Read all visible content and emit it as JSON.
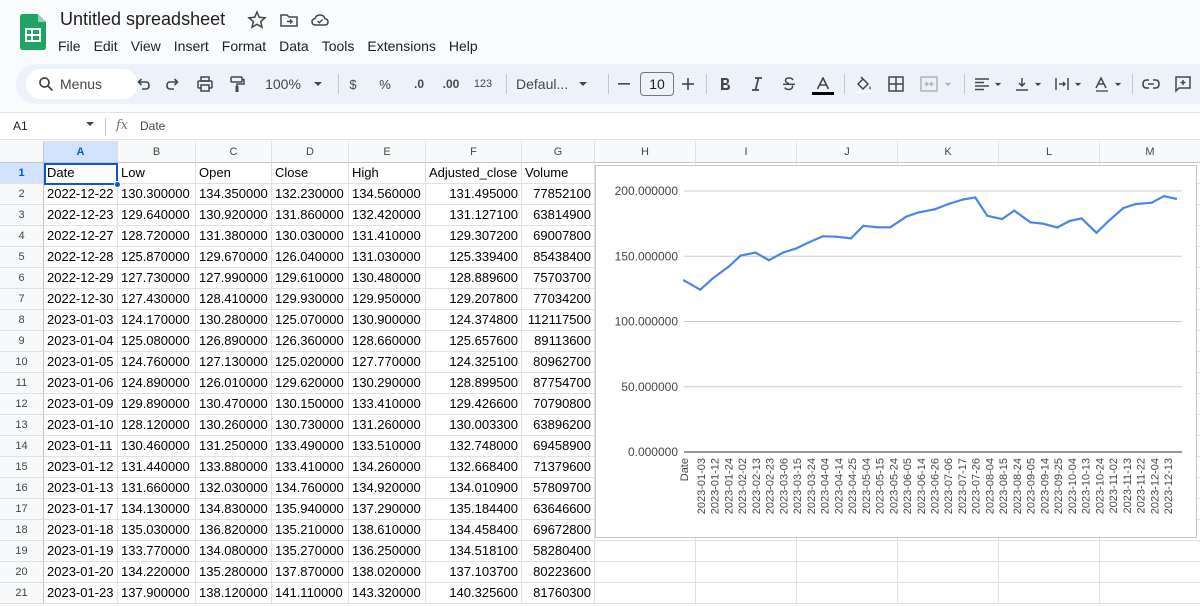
{
  "app": {
    "title": "Untitled spreadsheet",
    "menu": [
      "File",
      "Edit",
      "View",
      "Insert",
      "Format",
      "Data",
      "Tools",
      "Extensions",
      "Help"
    ]
  },
  "toolbar": {
    "search_label": "Menus",
    "zoom": "100%",
    "currency": "$",
    "percent": "%",
    "decrease_decimal": ".0",
    "increase_decimal": ".00",
    "number_format": "123",
    "font": "Defaul...",
    "font_size": "10"
  },
  "formula_bar": {
    "cell_ref": "A1",
    "fx": "fx",
    "value": "Date"
  },
  "grid": {
    "columns": [
      "A",
      "B",
      "C",
      "D",
      "E",
      "F",
      "G",
      "H",
      "I",
      "J",
      "K",
      "L",
      "M"
    ],
    "row_numbers": [
      "1",
      "2",
      "3",
      "4",
      "5",
      "6",
      "7",
      "8",
      "9",
      "10",
      "11",
      "12",
      "13",
      "14",
      "15",
      "16",
      "17",
      "18",
      "19",
      "20",
      "21"
    ],
    "header_row": [
      "Date",
      "Low",
      "Open",
      "Close",
      "High",
      "Adjusted_close",
      "Volume"
    ],
    "rows": [
      [
        "2022-12-22",
        "130.300000",
        "134.350000",
        "132.230000",
        "134.560000",
        "131.495000",
        "77852100"
      ],
      [
        "2022-12-23",
        "129.640000",
        "130.920000",
        "131.860000",
        "132.420000",
        "131.127100",
        "63814900"
      ],
      [
        "2022-12-27",
        "128.720000",
        "131.380000",
        "130.030000",
        "131.410000",
        "129.307200",
        "69007800"
      ],
      [
        "2022-12-28",
        "125.870000",
        "129.670000",
        "126.040000",
        "131.030000",
        "125.339400",
        "85438400"
      ],
      [
        "2022-12-29",
        "127.730000",
        "127.990000",
        "129.610000",
        "130.480000",
        "128.889600",
        "75703700"
      ],
      [
        "2022-12-30",
        "127.430000",
        "128.410000",
        "129.930000",
        "129.950000",
        "129.207800",
        "77034200"
      ],
      [
        "2023-01-03",
        "124.170000",
        "130.280000",
        "125.070000",
        "130.900000",
        "124.374800",
        "112117500"
      ],
      [
        "2023-01-04",
        "125.080000",
        "126.890000",
        "126.360000",
        "128.660000",
        "125.657600",
        "89113600"
      ],
      [
        "2023-01-05",
        "124.760000",
        "127.130000",
        "125.020000",
        "127.770000",
        "124.325100",
        "80962700"
      ],
      [
        "2023-01-06",
        "124.890000",
        "126.010000",
        "129.620000",
        "130.290000",
        "128.899500",
        "87754700"
      ],
      [
        "2023-01-09",
        "129.890000",
        "130.470000",
        "130.150000",
        "133.410000",
        "129.426600",
        "70790800"
      ],
      [
        "2023-01-10",
        "128.120000",
        "130.260000",
        "130.730000",
        "131.260000",
        "130.003300",
        "63896200"
      ],
      [
        "2023-01-11",
        "130.460000",
        "131.250000",
        "133.490000",
        "133.510000",
        "132.748000",
        "69458900"
      ],
      [
        "2023-01-12",
        "131.440000",
        "133.880000",
        "133.410000",
        "134.260000",
        "132.668400",
        "71379600"
      ],
      [
        "2023-01-13",
        "131.660000",
        "132.030000",
        "134.760000",
        "134.920000",
        "134.010900",
        "57809700"
      ],
      [
        "2023-01-17",
        "134.130000",
        "134.830000",
        "135.940000",
        "137.290000",
        "135.184400",
        "63646600"
      ],
      [
        "2023-01-18",
        "135.030000",
        "136.820000",
        "135.210000",
        "138.610000",
        "134.458400",
        "69672800"
      ],
      [
        "2023-01-19",
        "133.770000",
        "134.080000",
        "135.270000",
        "136.250000",
        "134.518100",
        "58280400"
      ],
      [
        "2023-01-20",
        "134.220000",
        "135.280000",
        "137.870000",
        "138.020000",
        "137.103700",
        "80223600"
      ],
      [
        "2023-01-23",
        "137.900000",
        "138.120000",
        "141.110000",
        "143.320000",
        "140.325600",
        "81760300"
      ]
    ]
  },
  "chart_data": {
    "type": "line",
    "title": "",
    "xlabel": "Date",
    "ylabel": "",
    "ylim": [
      0,
      200
    ],
    "y_ticks": [
      "0.000000",
      "50.000000",
      "100.000000",
      "150.000000",
      "200.000000"
    ],
    "x_tick_labels": [
      "2023-01-03",
      "2023-01-12",
      "2023-01-24",
      "2023-02-02",
      "2023-02-13",
      "2023-02-23",
      "2023-03-06",
      "2023-03-15",
      "2023-03-24",
      "2023-04-04",
      "2023-04-14",
      "2023-04-25",
      "2023-05-04",
      "2023-05-15",
      "2023-05-24",
      "2023-06-05",
      "2023-06-14",
      "2023-06-26",
      "2023-07-06",
      "2023-07-17",
      "2023-07-26",
      "2023-08-04",
      "2023-08-15",
      "2023-08-24",
      "2023-09-05",
      "2023-09-14",
      "2023-09-25",
      "2023-10-04",
      "2023-10-13",
      "2023-10-24",
      "2023-11-02",
      "2023-11-13",
      "2023-11-22",
      "2023-12-04",
      "2023-12-13"
    ],
    "series_color": "#4a86e8",
    "gridlines": true,
    "legend": "none",
    "series": [
      {
        "x": [
          "2022-12-22",
          "2023-01-03",
          "2023-01-12",
          "2023-01-24",
          "2023-02-02",
          "2023-02-13",
          "2023-02-23",
          "2023-03-06",
          "2023-03-15",
          "2023-03-24",
          "2023-04-04",
          "2023-04-14",
          "2023-04-25",
          "2023-05-04",
          "2023-05-15",
          "2023-05-24",
          "2023-06-05",
          "2023-06-14",
          "2023-06-26",
          "2023-07-06",
          "2023-07-17",
          "2023-07-26",
          "2023-08-04",
          "2023-08-15",
          "2023-08-24",
          "2023-09-05",
          "2023-09-14",
          "2023-09-25",
          "2023-10-04",
          "2023-10-13",
          "2023-10-24",
          "2023-11-02",
          "2023-11-13",
          "2023-11-22",
          "2023-12-04",
          "2023-12-13",
          "2023-12-22"
        ],
        "values": [
          131.5,
          124.4,
          132.7,
          141.9,
          150.5,
          152.8,
          147.0,
          153.0,
          155.9,
          160.3,
          165.3,
          165.0,
          163.7,
          173.3,
          172.1,
          172.2,
          180.4,
          183.6,
          186.0,
          190.0,
          193.5,
          195.1,
          181.0,
          178.5,
          185.0,
          176.0,
          175.0,
          172.0,
          177.0,
          179.0,
          168.0,
          177.0,
          187.0,
          190.0,
          191.0,
          196.0,
          194.0
        ]
      }
    ]
  }
}
